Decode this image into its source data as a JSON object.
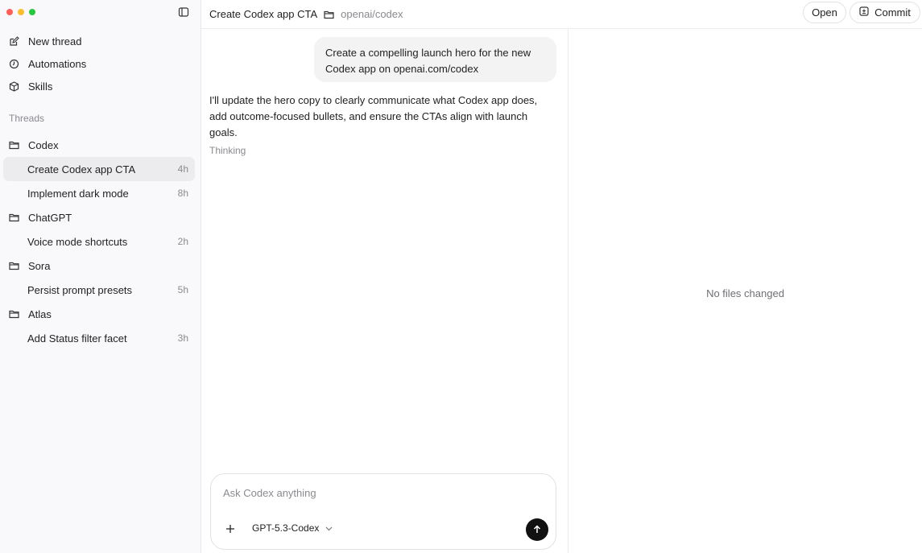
{
  "window": {
    "traffic_lights": [
      "#ff5f57",
      "#febc2e",
      "#28c840"
    ]
  },
  "sidebar": {
    "nav": [
      {
        "label": "New thread",
        "icon": "compose-icon"
      },
      {
        "label": "Automations",
        "icon": "clock-icon"
      },
      {
        "label": "Skills",
        "icon": "cube-icon"
      }
    ],
    "section_label": "Threads",
    "groups": [
      {
        "name": "Codex",
        "threads": [
          {
            "title": "Create Codex app CTA",
            "age": "4h",
            "active": true
          },
          {
            "title": "Implement dark mode",
            "age": "8h"
          }
        ]
      },
      {
        "name": "ChatGPT",
        "threads": [
          {
            "title": "Voice mode shortcuts",
            "age": "2h"
          }
        ]
      },
      {
        "name": "Sora",
        "threads": [
          {
            "title": "Persist prompt presets",
            "age": "5h"
          }
        ]
      },
      {
        "name": "Atlas",
        "threads": [
          {
            "title": "Add Status filter facet",
            "age": "3h"
          }
        ]
      }
    ]
  },
  "header": {
    "title": "Create Codex app CTA",
    "repo": "openai/codex",
    "open_label": "Open",
    "commit_label": "Commit"
  },
  "chat": {
    "user_message": "Create a compelling launch hero for the new Codex app on openai.com/codex",
    "assistant_message": "I'll update the hero copy to clearly communicate what Codex app does, add outcome-focused bullets, and ensure the CTAs align with launch goals.",
    "status": "Thinking"
  },
  "composer": {
    "placeholder": "Ask Codex anything",
    "model": "GPT-5.3-Codex"
  },
  "files_panel": {
    "empty_text": "No files changed"
  }
}
